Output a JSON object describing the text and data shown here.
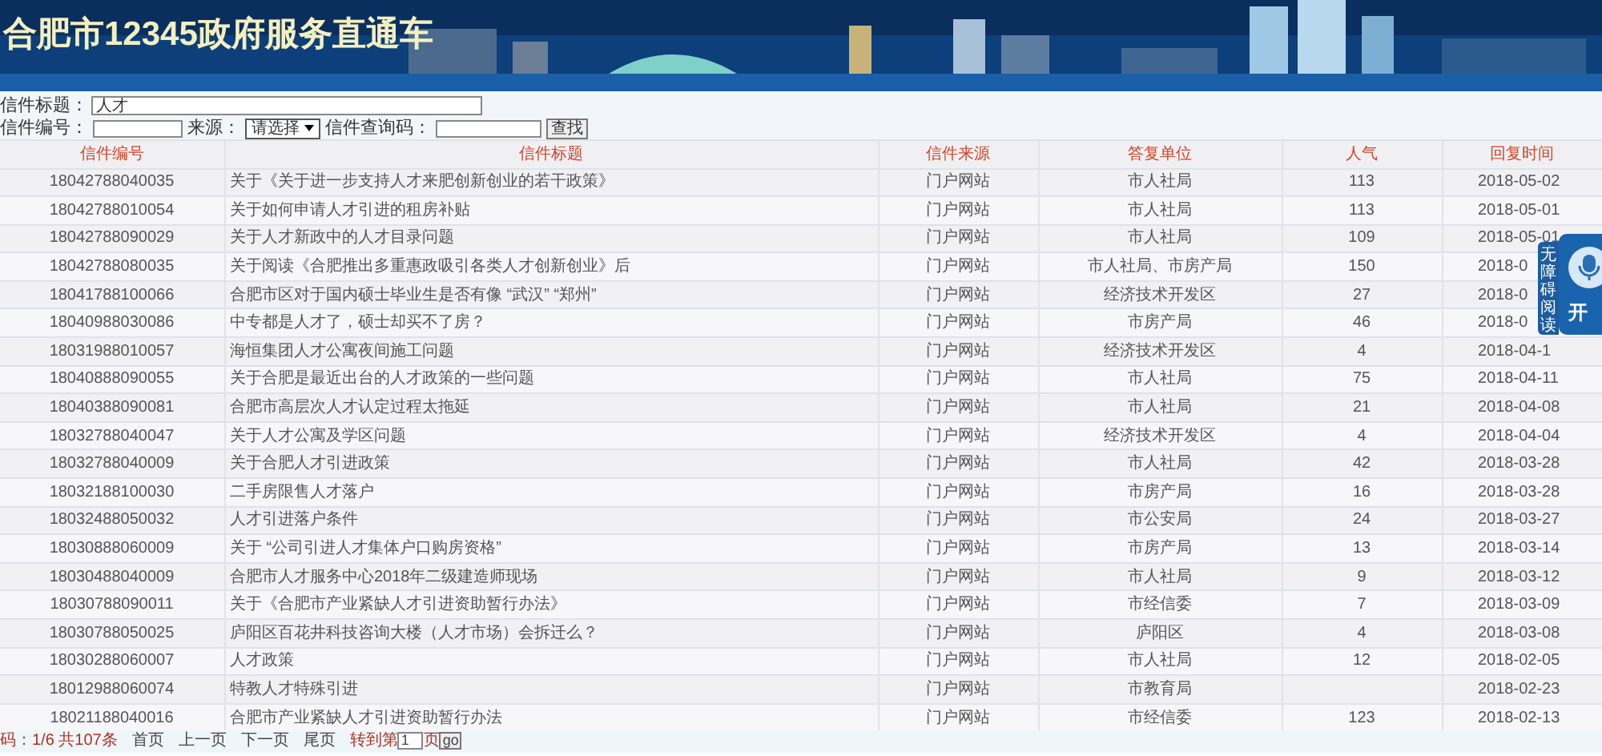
{
  "header": {
    "title": "合肥市12345政府服务直通车"
  },
  "search": {
    "title_label": "信件标题：",
    "title_value": "人才",
    "number_label": "信件编号：",
    "source_label": "来源：",
    "source_value": "请选择",
    "code_label": "信件查询码：",
    "button": "查找"
  },
  "table": {
    "columns": [
      "信件编号",
      "信件标题",
      "信件来源",
      "答复单位",
      "人气",
      "回复时间"
    ],
    "rows": [
      [
        "18042788040035",
        "关于《关于进一步支持人才来肥创新创业的若干政策》",
        "门户网站",
        "市人社局",
        "113",
        "2018-05-02"
      ],
      [
        "18042788010054",
        "关于如何申请人才引进的租房补贴",
        "门户网站",
        "市人社局",
        "113",
        "2018-05-01"
      ],
      [
        "18042788090029",
        "关于人才新政中的人才目录问题",
        "门户网站",
        "市人社局",
        "109",
        "2018-05-01"
      ],
      [
        "18042788080035",
        "关于阅读《合肥推出多重惠政吸引各类人才创新创业》后",
        "门户网站",
        "市人社局、市房产局",
        "150",
        "2018-0"
      ],
      [
        "18041788100066",
        "合肥市区对于国内硕士毕业生是否有像 “武汉”  “郑州”",
        "门户网站",
        "经济技术开发区",
        "27",
        "2018-0"
      ],
      [
        "18040988030086",
        "中专都是人才了，硕士却买不了房？",
        "门户网站",
        "市房产局",
        "46",
        "2018-0"
      ],
      [
        "18031988010057",
        "海恒集团人才公寓夜间施工问题",
        "门户网站",
        "经济技术开发区",
        "4",
        "2018-04-1"
      ],
      [
        "18040888090055",
        "关于合肥是最近出台的人才政策的一些问题",
        "门户网站",
        "市人社局",
        "75",
        "2018-04-11"
      ],
      [
        "18040388090081",
        "合肥市高层次人才认定过程太拖延",
        "门户网站",
        "市人社局",
        "21",
        "2018-04-08"
      ],
      [
        "18032788040047",
        "关于人才公寓及学区问题",
        "门户网站",
        "经济技术开发区",
        "4",
        "2018-04-04"
      ],
      [
        "18032788040009",
        "关于合肥人才引进政策",
        "门户网站",
        "市人社局",
        "42",
        "2018-03-28"
      ],
      [
        "18032188100030",
        "二手房限售人才落户",
        "门户网站",
        "市房产局",
        "16",
        "2018-03-28"
      ],
      [
        "18032488050032",
        "人才引进落户条件",
        "门户网站",
        "市公安局",
        "24",
        "2018-03-27"
      ],
      [
        "18030888060009",
        "关于 “公司引进人才集体户口购房资格”",
        "门户网站",
        "市房产局",
        "13",
        "2018-03-14"
      ],
      [
        "18030488040009",
        "合肥市人才服务中心2018年二级建造师现场",
        "门户网站",
        "市人社局",
        "9",
        "2018-03-12"
      ],
      [
        "18030788090011",
        "关于《合肥市产业紧缺人才引进资助暂行办法》",
        "门户网站",
        "市经信委",
        "7",
        "2018-03-09"
      ],
      [
        "18030788050025",
        "庐阳区百花井科技咨询大楼（人才市场）会拆迁么？",
        "门户网站",
        "庐阳区",
        "4",
        "2018-03-08"
      ],
      [
        "18030288060007",
        "人才政策",
        "门户网站",
        "市人社局",
        "12",
        "2018-02-05"
      ],
      [
        "18012988060074",
        "特教人才特殊引进",
        "门户网站",
        "市教育局",
        "",
        "2018-02-23"
      ],
      [
        "18021188040016",
        "合肥市产业紧缺人才引进资助暂行办法",
        "门户网站",
        "市经信委",
        "123",
        "2018-02-13"
      ]
    ]
  },
  "pagination": {
    "summary": "码：1/6  共107条",
    "first": "首页",
    "prev": "上一页",
    "next": "下一页",
    "last": "尾页",
    "goto_label": "转到第",
    "page_value": "1",
    "page_suffix": "页",
    "go": "go"
  },
  "accessibility_widget": {
    "tab_label": "无障碍阅读",
    "button_label": "开"
  }
}
